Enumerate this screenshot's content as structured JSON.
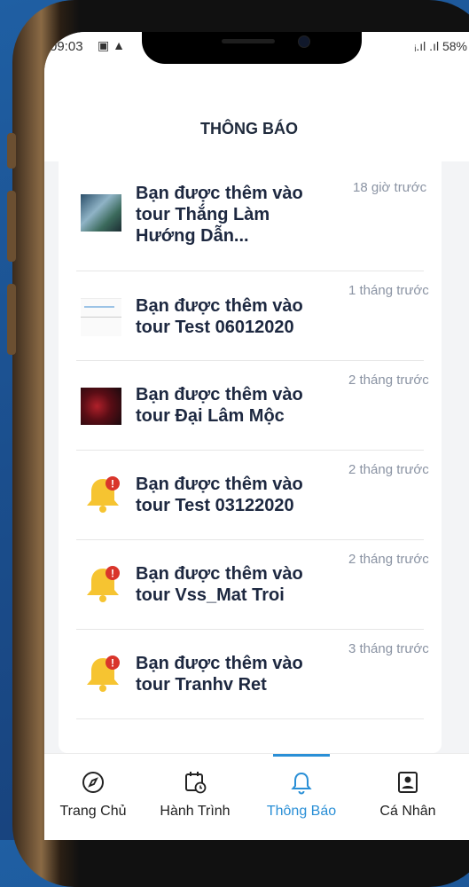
{
  "status_bar": {
    "time": "09:03",
    "left_icons": "▣ ▲",
    "battery": "58%",
    "signal": "ᵢ.ıl .ıl"
  },
  "header": {
    "title": "THÔNG BÁO"
  },
  "notifications": [
    {
      "text": "Bạn được thêm vào\ntour Thắng Làm\nHướng Dẫn...",
      "time": "18 giờ trước",
      "icon": "tour-image"
    },
    {
      "text": "Bạn được thêm vào\ntour Test 06012020",
      "time": "1 tháng\ntrước",
      "icon": "tour-image"
    },
    {
      "text": "Bạn được thêm vào\ntour Đại Lâm Mộc",
      "time": "2 tháng\ntrước",
      "icon": "tour-image"
    },
    {
      "text": "Bạn được thêm vào\ntour  Test 03122020",
      "time": "2 tháng\ntrước",
      "icon": "bell-icon"
    },
    {
      "text": "Bạn được thêm vào\ntour Vss_Mat Troi",
      "time": "2 tháng\ntrước",
      "icon": "bell-icon"
    },
    {
      "text": "Bạn được thêm vào\ntour Tranhv Ret",
      "time": "3 tháng\ntrước",
      "icon": "bell-icon"
    }
  ],
  "badge_text": "!",
  "nav": {
    "home": "Trang Chủ",
    "itinerary": "Hành Trình",
    "notifications": "Thông Báo",
    "profile": "Cá Nhân",
    "active": "notifications",
    "accent_color": "#2a8fd6"
  }
}
